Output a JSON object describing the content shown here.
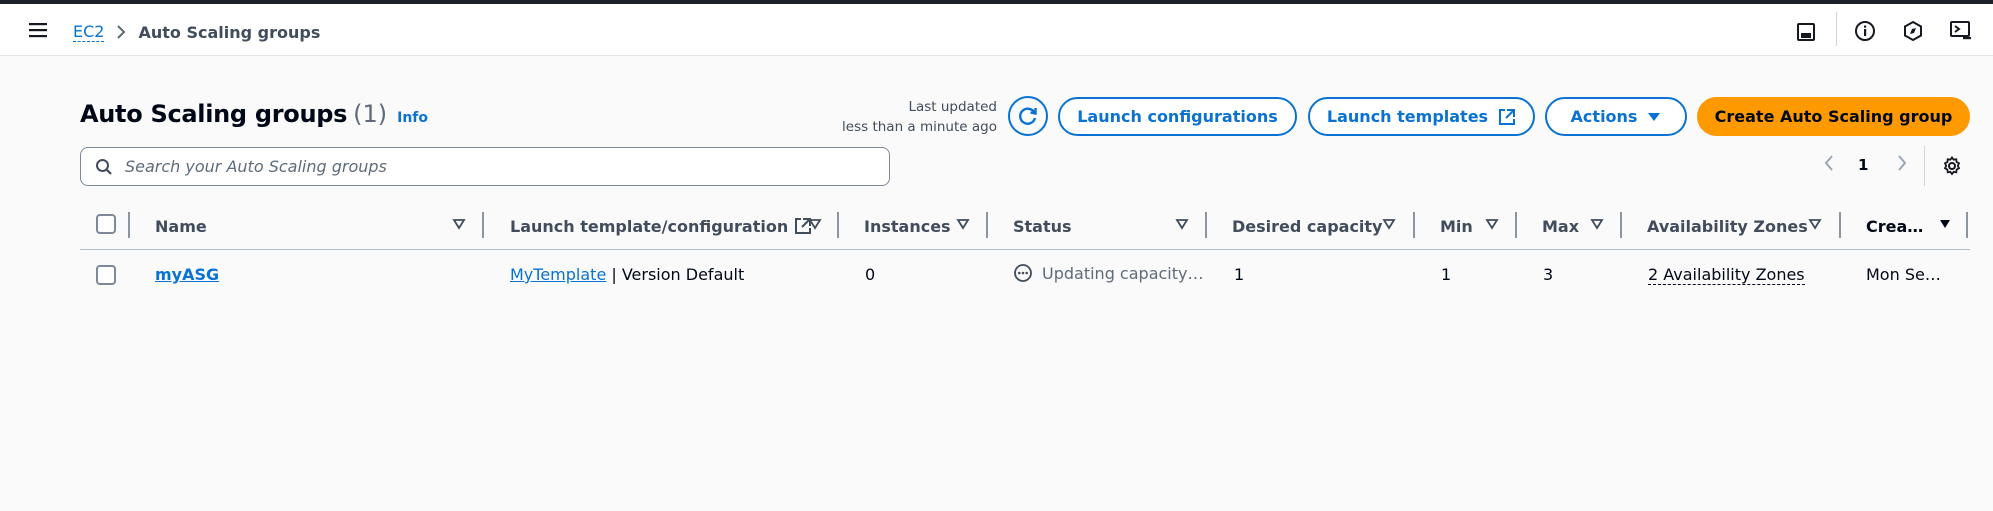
{
  "topbar": {
    "breadcrumb": {
      "root": "EC2",
      "current": "Auto Scaling groups"
    }
  },
  "header": {
    "title": "Auto Scaling groups",
    "count": "(1)",
    "info": "Info",
    "updated_line1": "Last updated",
    "updated_line2": "less than a minute ago"
  },
  "buttons": {
    "launch_configurations": "Launch configurations",
    "launch_templates": "Launch templates",
    "actions": "Actions",
    "create": "Create Auto Scaling group"
  },
  "search": {
    "placeholder": "Search your Auto Scaling groups",
    "value": ""
  },
  "pagination": {
    "current_page": "1"
  },
  "table": {
    "columns": [
      "Name",
      "Launch template/configuration",
      "Instances",
      "Status",
      "Desired capacity",
      "Min",
      "Max",
      "Availability Zones",
      "Crea…"
    ],
    "rows": [
      {
        "name": "myASG",
        "template_link": "MyTemplate",
        "template_rest": " | Version Default",
        "instances": "0",
        "status": "Updating capacity…",
        "desired": "1",
        "min": "1",
        "max": "3",
        "azs": "2 Availability Zones",
        "created": "Mon Se…"
      }
    ]
  },
  "colors": {
    "accent": "#0972d3",
    "primary": "#ff9900",
    "text": "#000716"
  }
}
